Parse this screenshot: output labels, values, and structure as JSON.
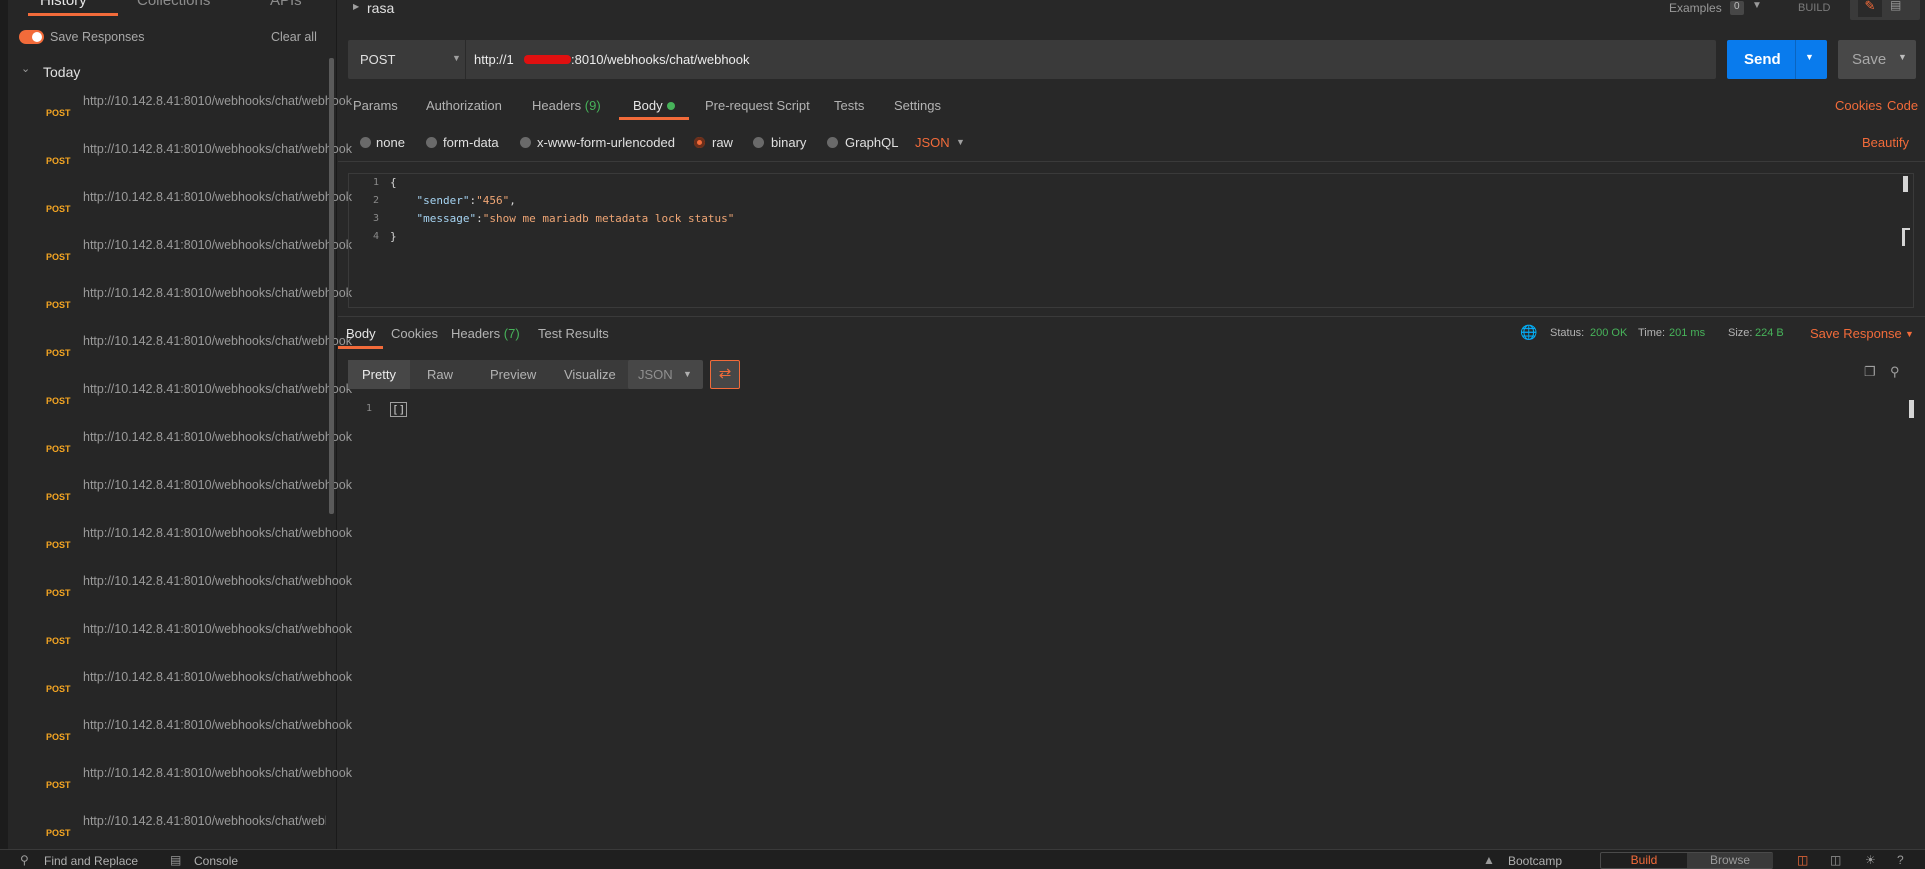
{
  "sidebar": {
    "tabs": [
      "History",
      "Collections",
      "APIs"
    ],
    "save_responses_label": "Save Responses",
    "clear_all_label": "Clear all",
    "group_label": "Today",
    "items": [
      {
        "method": "POST",
        "url": "http://10.142.8.41:8010/webhooks/chat/webhook"
      },
      {
        "method": "POST",
        "url": "http://10.142.8.41:8010/webhooks/chat/webhook"
      },
      {
        "method": "POST",
        "url": "http://10.142.8.41:8010/webhooks/chat/webhook"
      },
      {
        "method": "POST",
        "url": "http://10.142.8.41:8010/webhooks/chat/webhook"
      },
      {
        "method": "POST",
        "url": "http://10.142.8.41:8010/webhooks/chat/webhook"
      },
      {
        "method": "POST",
        "url": "http://10.142.8.41:8010/webhooks/chat/webhook"
      },
      {
        "method": "POST",
        "url": "http://10.142.8.41:8010/webhooks/chat/webhook"
      },
      {
        "method": "POST",
        "url": "http://10.142.8.41:8010/webhooks/chat/webhook"
      },
      {
        "method": "POST",
        "url": "http://10.142.8.41:8010/webhooks/chat/webhook"
      },
      {
        "method": "POST",
        "url": "http://10.142.8.41:8010/webhooks/chat/webhook"
      },
      {
        "method": "POST",
        "url": "http://10.142.8.41:8010/webhooks/chat/webhook"
      },
      {
        "method": "POST",
        "url": "http://10.142.8.41:8010/webhooks/chat/webhook"
      },
      {
        "method": "POST",
        "url": "http://10.142.8.41:8010/webhooks/chat/webhook"
      },
      {
        "method": "POST",
        "url": "http://10.142.8.41:8010/webhooks/chat/webhook"
      },
      {
        "method": "POST",
        "url": "http://10.142.8.41:8010/webhooks/chat/webhook"
      },
      {
        "method": "POST",
        "url": "http://10.142.8.41:8010/webhooks/chat/webhook"
      }
    ]
  },
  "header": {
    "request_name": "rasa",
    "examples_label": "Examples",
    "examples_count": "0",
    "build_label": "BUILD"
  },
  "request": {
    "method": "POST",
    "url_prefix": "http://1",
    "url_suffix": ":8010/webhooks/chat/webhook",
    "send_label": "Send",
    "save_label": "Save"
  },
  "request_tabs": {
    "params": "Params",
    "authorization": "Authorization",
    "headers": "Headers",
    "headers_count": "(9)",
    "body": "Body",
    "prerequest": "Pre-request Script",
    "tests": "Tests",
    "settings": "Settings",
    "cookies": "Cookies",
    "code": "Code"
  },
  "body_options": {
    "none": "none",
    "form_data": "form-data",
    "urlencoded": "x-www-form-urlencoded",
    "raw": "raw",
    "binary": "binary",
    "graphql": "GraphQL",
    "format": "JSON",
    "beautify": "Beautify"
  },
  "request_body": {
    "line_numbers": [
      "1",
      "2",
      "3",
      "4"
    ],
    "open_brace": "{",
    "line2_key": "\"sender\"",
    "line2_value": "\"456\"",
    "line3_key": "\"message\"",
    "line3_value": "\"show me mariadb metadata lock status\"",
    "close_brace": "}"
  },
  "response": {
    "tabs": {
      "body": "Body",
      "cookies": "Cookies",
      "headers": "Headers",
      "headers_count": "(7)",
      "test_results": "Test Results"
    },
    "status_label": "Status:",
    "status_value": "200 OK",
    "time_label": "Time:",
    "time_value": "201 ms",
    "size_label": "Size:",
    "size_value": "224 B",
    "save_response_label": "Save Response",
    "view_tabs": {
      "pretty": "Pretty",
      "raw": "Raw",
      "preview": "Preview",
      "visualize": "Visualize"
    },
    "format": "JSON",
    "line_number": "1",
    "body_text": "[]"
  },
  "footer": {
    "find_replace": "Find and Replace",
    "console": "Console",
    "bootcamp": "Bootcamp",
    "build": "Build",
    "browse": "Browse"
  },
  "colors": {
    "accent": "#f26b3a",
    "send_blue": "#097bed",
    "status_green": "#47b35a",
    "post_method": "#f5a623"
  }
}
